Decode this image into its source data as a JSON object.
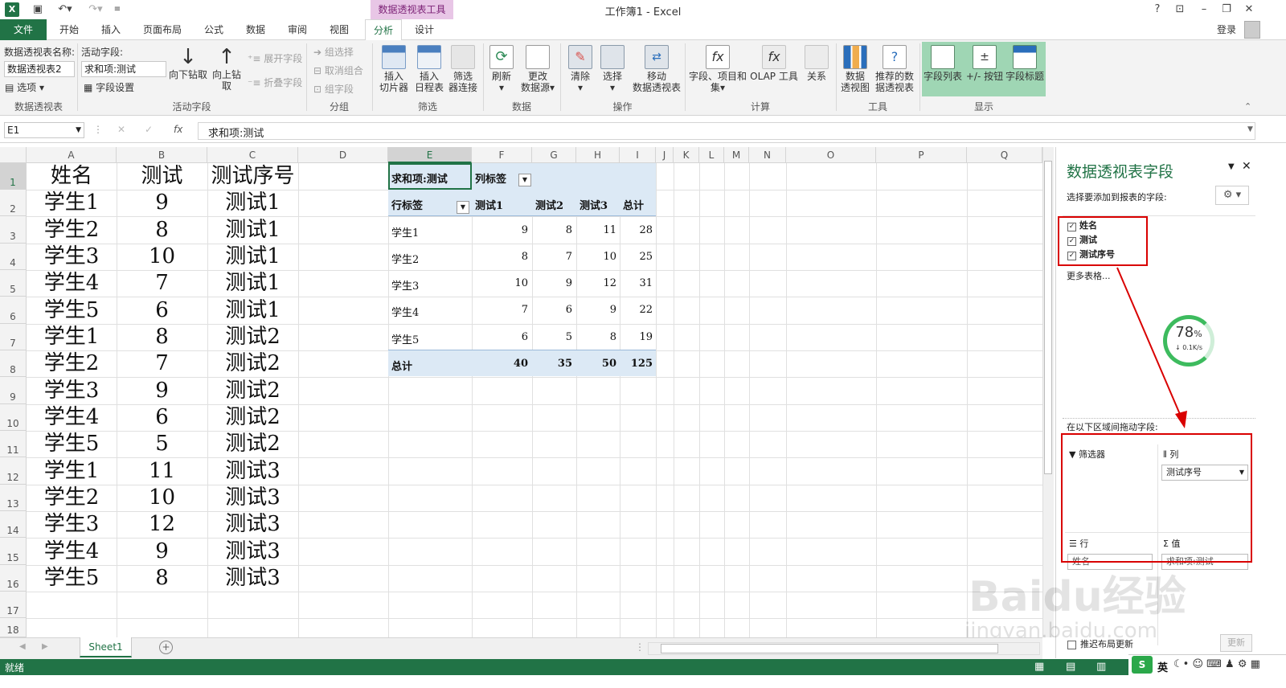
{
  "window": {
    "title": "工作簿1 - Excel",
    "context_tab_group": "数据透视表工具",
    "login": "登录"
  },
  "tabs": [
    "文件",
    "开始",
    "插入",
    "页面布局",
    "公式",
    "数据",
    "审阅",
    "视图",
    "分析",
    "设计"
  ],
  "ribbon": {
    "pivot_name_label": "数据透视表名称:",
    "pivot_name_value": "数据透视表2",
    "options": "选项",
    "group_pivot": "数据透视表",
    "active_field_label": "活动字段:",
    "active_field_value": "求和项:测试",
    "field_settings": "字段设置",
    "drill_down": "向下钻取",
    "drill_up_1": "向上钻",
    "drill_up_2": "取",
    "expand_field": "展开字段",
    "collapse_field": "折叠字段",
    "group_active": "活动字段",
    "group_selection": "组选择",
    "ungroup": "取消组合",
    "group_field": "组字段",
    "group_group": "分组",
    "insert_slicer_1": "插入",
    "insert_slicer_2": "切片器",
    "insert_timeline_1": "插入",
    "insert_timeline_2": "日程表",
    "filter_conn_1": "筛选",
    "filter_conn_2": "器连接",
    "group_filter": "筛选",
    "refresh": "刷新",
    "change_source_1": "更改",
    "change_source_2": "数据源",
    "group_data": "数据",
    "clear": "清除",
    "select": "选择",
    "move_1": "移动",
    "move_2": "数据透视表",
    "group_actions": "操作",
    "fields_items_1": "字段、项目和",
    "fields_items_2": "集",
    "olap": "OLAP 工具",
    "relations": "关系",
    "group_calc": "计算",
    "pivot_chart_1": "数据",
    "pivot_chart_2": "透视图",
    "recommended_1": "推荐的数",
    "recommended_2": "据透视表",
    "group_tools": "工具",
    "field_list": "字段列表",
    "plus_minus": "+/- 按钮",
    "field_headers": "字段标题",
    "group_show": "显示"
  },
  "formula_bar": {
    "name_box": "E1",
    "fx": "fx",
    "content": "求和项:测试"
  },
  "columns": [
    "A",
    "B",
    "C",
    "D",
    "E",
    "F",
    "G",
    "H",
    "I",
    "J",
    "K",
    "L",
    "M",
    "N",
    "O",
    "P",
    "Q"
  ],
  "rows": [
    "1",
    "2",
    "3",
    "4",
    "5",
    "6",
    "7",
    "8",
    "9",
    "10",
    "11",
    "12",
    "13",
    "14",
    "15",
    "16",
    "17",
    "18"
  ],
  "source_table": {
    "header": [
      "姓名",
      "测试",
      "测试序号"
    ],
    "rows": [
      [
        "学生1",
        "9",
        "测试1"
      ],
      [
        "学生2",
        "8",
        "测试1"
      ],
      [
        "学生3",
        "10",
        "测试1"
      ],
      [
        "学生4",
        "7",
        "测试1"
      ],
      [
        "学生5",
        "6",
        "测试1"
      ],
      [
        "学生1",
        "8",
        "测试2"
      ],
      [
        "学生2",
        "7",
        "测试2"
      ],
      [
        "学生3",
        "9",
        "测试2"
      ],
      [
        "学生4",
        "6",
        "测试2"
      ],
      [
        "学生5",
        "5",
        "测试2"
      ],
      [
        "学生1",
        "11",
        "测试3"
      ],
      [
        "学生2",
        "10",
        "测试3"
      ],
      [
        "学生3",
        "12",
        "测试3"
      ],
      [
        "学生4",
        "9",
        "测试3"
      ],
      [
        "学生5",
        "8",
        "测试3"
      ]
    ]
  },
  "pivot": {
    "value_label": "求和项:测试",
    "col_label": "列标签",
    "row_label": "行标签",
    "col_headers": [
      "测试1",
      "测试2",
      "测试3",
      "总计"
    ],
    "rows": [
      {
        "name": "学生1",
        "vals": [
          "9",
          "8",
          "11",
          "28"
        ]
      },
      {
        "name": "学生2",
        "vals": [
          "8",
          "7",
          "10",
          "25"
        ]
      },
      {
        "name": "学生3",
        "vals": [
          "10",
          "9",
          "12",
          "31"
        ]
      },
      {
        "name": "学生4",
        "vals": [
          "7",
          "6",
          "9",
          "22"
        ]
      },
      {
        "name": "学生5",
        "vals": [
          "6",
          "5",
          "8",
          "19"
        ]
      }
    ],
    "total": {
      "name": "总计",
      "vals": [
        "40",
        "35",
        "50",
        "125"
      ]
    }
  },
  "panel": {
    "title": "数据透视表字段",
    "subtitle": "选择要添加到报表的字段:",
    "fields": [
      "姓名",
      "测试",
      "测试序号"
    ],
    "more_tables": "更多表格...",
    "drag_label": "在以下区域间拖动字段:",
    "filters": "筛选器",
    "columns": "列",
    "column_item": "测试序号",
    "rows": "行",
    "row_item": "姓名",
    "values": "值",
    "value_item": "求和项:测试",
    "defer": "推迟布局更新",
    "update": "更新"
  },
  "net_widget": {
    "percent": "78",
    "unit": "%",
    "speed": "0.1K/s"
  },
  "sheets": {
    "active": "Sheet1"
  },
  "status": {
    "ready": "就绪",
    "ime": "英"
  },
  "watermark": {
    "line1": "Baidu经验",
    "line2": "jingyan.baidu.com"
  },
  "colors": {
    "excel_green": "#217346",
    "pivot_header_bg": "#dce9f5",
    "context_tab": "#e8c6e6",
    "annotation_red": "#d90000",
    "show_group_bg": "#9fd6b4"
  }
}
